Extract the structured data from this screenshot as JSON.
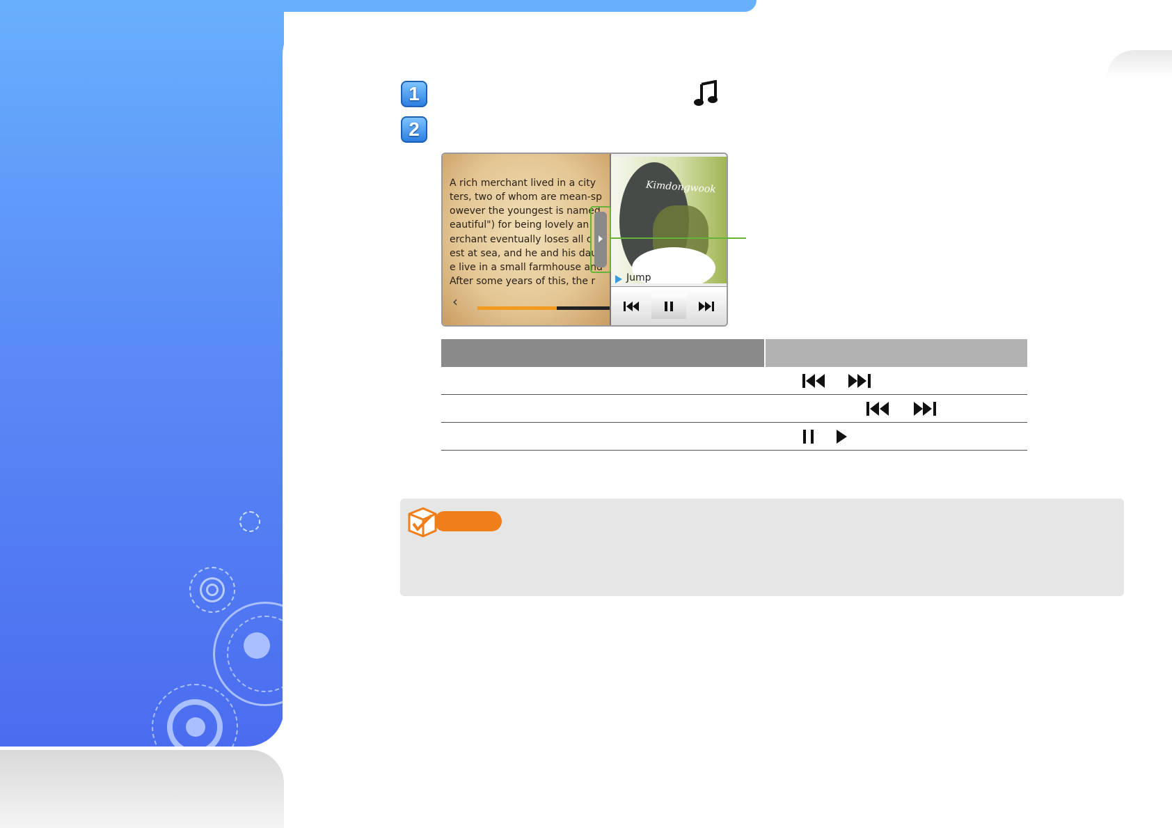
{
  "colors": {
    "sidebar_top": "#68b0fd",
    "sidebar_bottom": "#4b6cef",
    "step_badge": "#2e7fe0",
    "callout_green": "#67b33a",
    "table_header_dark": "#8a8a8a",
    "table_header_light": "#b2b2b2",
    "note_background": "#e6e6e6",
    "note_pill": "#f07e1a",
    "progress_fill": "#f29a1d"
  },
  "steps": [
    {
      "number": "1",
      "icon": "music-note-icon"
    },
    {
      "number": "2"
    }
  ],
  "device": {
    "book_text": [
      "A rich merchant lived in a city",
      "ters, two of whom are mean-sp",
      "owever the youngest is named",
      "eautiful\") for being lovely an",
      "erchant eventually loses all c",
      "est at sea, and he and his dau",
      "e live in a small farmhouse and",
      " After some years of this, the r"
    ],
    "reading_progress": 0.6,
    "album_script": "Kimdongwook",
    "jump_label": "Jump",
    "player_controls": [
      "previous-track-icon",
      "pause-icon",
      "next-track-icon"
    ]
  },
  "table": {
    "rows": [
      {
        "icons": [
          "previous-track-icon",
          "next-track-icon"
        ]
      },
      {
        "icons": [
          "previous-track-icon",
          "next-track-icon"
        ]
      },
      {
        "icons": [
          "pause-icon",
          "play-icon"
        ]
      }
    ]
  },
  "note": {
    "icon": "note-checkbox-icon"
  }
}
